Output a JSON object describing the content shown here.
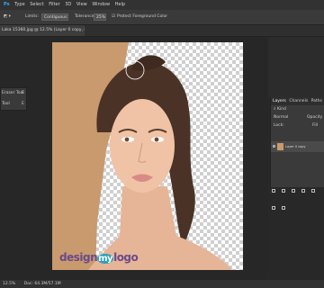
{
  "menu": [
    "Ps",
    "Type",
    "Select",
    "Filter",
    "3D",
    "View",
    "Window",
    "Help"
  ],
  "options": {
    "limits_label": "Limits:",
    "limits_value": "Contiguous",
    "tolerance_label": "Tolerance:",
    "tolerance_value": "25%",
    "protect_label": "Protect Foreground Color"
  },
  "tab": {
    "title": "Laka 15360.jpg @ 12.5% (Layer 0 copy, RGB/8) *"
  },
  "tools": [
    {
      "label": "Eraser Tool",
      "key": "E"
    },
    {
      "label": "Tool",
      "key": "E"
    }
  ],
  "layers_panel": {
    "tabs": [
      "Layers",
      "Channels",
      "Paths"
    ],
    "kind_label": "Kind",
    "blend_mode": "Normal",
    "opacity_label": "Opacity",
    "lock_label": "Lock:",
    "fill_label": "Fill",
    "layer_name": "Layer 0 copy"
  },
  "status": {
    "zoom": "12.5%",
    "doc_info": "Doc: 64.3M/57.1M"
  },
  "watermark": {
    "part1": "design",
    "part2": "my",
    "part3": "logo"
  },
  "colors": {
    "background": "#c8a07a",
    "accent": "#2fa0b5",
    "brand": "#6b4a8a"
  }
}
